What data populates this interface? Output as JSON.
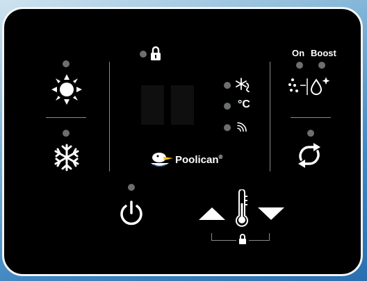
{
  "panel": {
    "brand": "Poolican",
    "registered_mark": "®",
    "boost_labels": {
      "on": "On",
      "boost": "Boost"
    },
    "temperature_unit": "°C"
  },
  "icons": {
    "heat_mode": "sun-icon",
    "cool_mode": "snowflake-icon",
    "lock": "padlock-icon",
    "defrost": "defrost-icon",
    "wifi": "wifi-icon",
    "boost": "boost-icon",
    "auto_mode": "cycle-icon",
    "power": "power-icon",
    "thermometer": "thermometer-icon",
    "up": "arrow-up-icon",
    "down": "arrow-down-icon"
  },
  "colors": {
    "panel": "#000000",
    "icon": "#ffffff",
    "led": "#6b6f72",
    "divider": "#8b8b8b"
  }
}
